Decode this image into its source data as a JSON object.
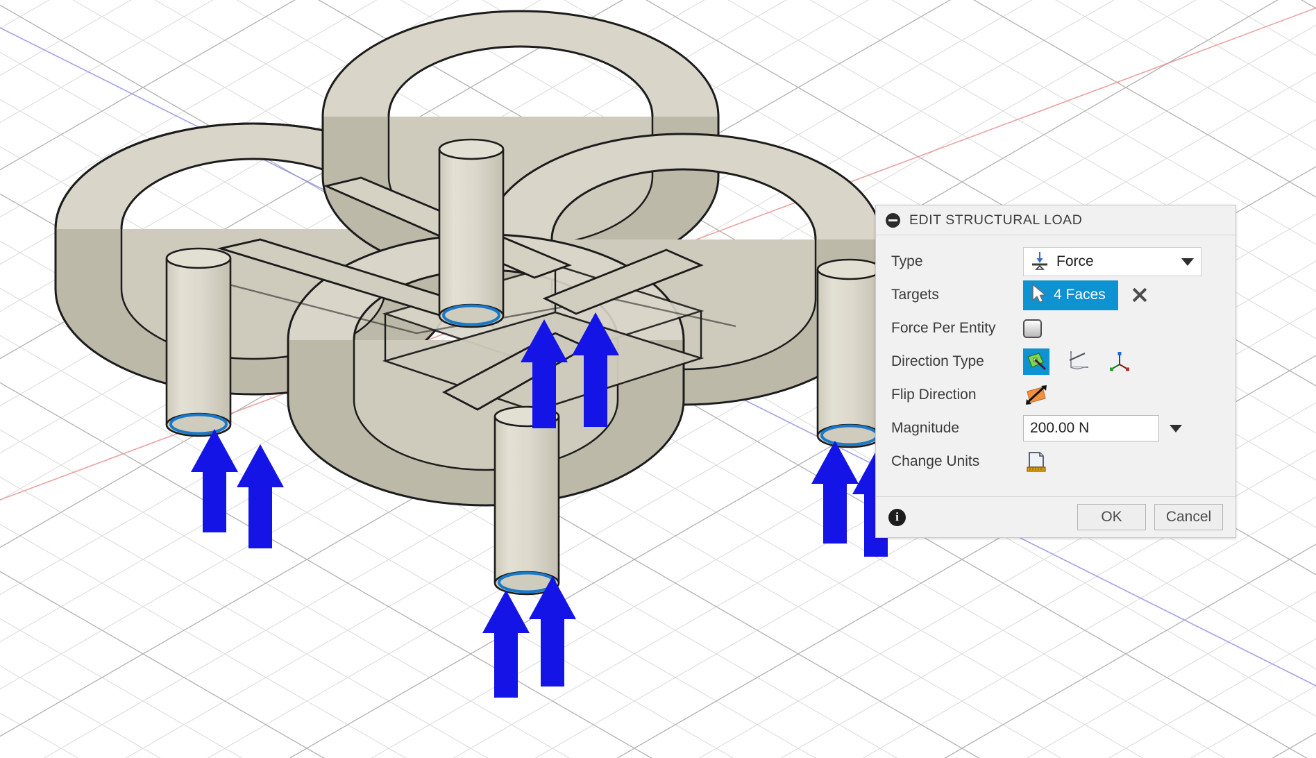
{
  "app": {
    "viewport_background": "#ffffff",
    "model_color": "#d9d6c9",
    "model_shade": "#b8b5a4",
    "model_edge": "#1c1c1c",
    "load_arrow_color": "#1414e6",
    "selection_highlight": "#1a78c8",
    "grid_color": "#d8d8d8",
    "grid_major_color": "#a8a8a8",
    "axis_x_color": "#e68a8a",
    "axis_y_color": "#8a8ae6"
  },
  "dialog": {
    "title": "EDIT STRUCTURAL LOAD",
    "collapse_icon": "minus-circle-icon",
    "rows": {
      "type": {
        "label": "Type",
        "value": "Force",
        "icon": "force-load-icon",
        "caret_icon": "chevron-down-icon"
      },
      "targets": {
        "label": "Targets",
        "value": "4 Faces",
        "select_icon": "cursor-arrow-icon",
        "clear_icon": "close-x-icon"
      },
      "force_per_entity": {
        "label": "Force Per Entity",
        "checked": false,
        "checkbox_icon": "checkbox-unchecked-icon"
      },
      "direction_type": {
        "label": "Direction Type",
        "options": [
          {
            "name": "normal-to-face-icon",
            "selected": true
          },
          {
            "name": "angle-direction-icon",
            "selected": false
          },
          {
            "name": "xyz-components-icon",
            "selected": false
          }
        ]
      },
      "flip_direction": {
        "label": "Flip Direction",
        "icon": "flip-direction-icon"
      },
      "magnitude": {
        "label": "Magnitude",
        "value": "200.00 N",
        "caret_icon": "chevron-down-icon"
      },
      "change_units": {
        "label": "Change Units",
        "icon": "document-ruler-icon"
      }
    },
    "footer": {
      "info_icon": "info-icon",
      "ok_label": "OK",
      "cancel_label": "Cancel"
    }
  }
}
